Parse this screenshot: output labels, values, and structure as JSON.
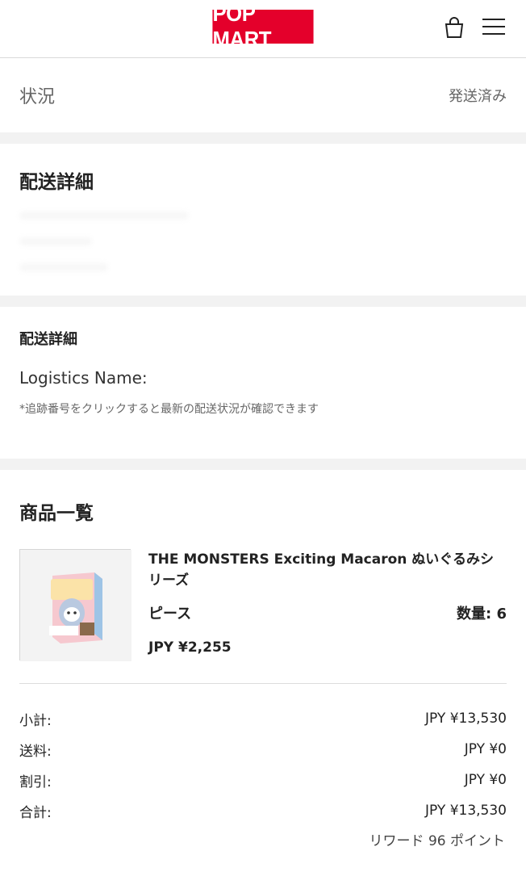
{
  "header": {
    "logo_text": "POP MART",
    "brand_color": "#e4002b",
    "cart_icon": "shopping-bag-icon",
    "menu_icon": "hamburger-menu-icon"
  },
  "status": {
    "label": "状況",
    "value": "発送済み"
  },
  "shipping": {
    "title": "配送詳細"
  },
  "logistics": {
    "title": "配送詳細",
    "name_label": "Logistics Name:",
    "note": "*追跡番号をクリックすると最新の配送状況が確認できます"
  },
  "products": {
    "title": "商品一覧",
    "items": [
      {
        "name": "THE MONSTERS Exciting Macaron ぬいぐるみシリーズ",
        "variant": "ピース",
        "quantity": "数量: 6",
        "price": "JPY ¥2,255"
      }
    ]
  },
  "totals": {
    "subtotal_label": "小計:",
    "subtotal_value": "JPY ¥13,530",
    "shipping_label": "送料:",
    "shipping_value": "JPY ¥0",
    "discount_label": "割引:",
    "discount_value": "JPY ¥0",
    "total_label": "合計:",
    "total_value": "JPY ¥13,530",
    "reward": "リワード 96 ポイント"
  }
}
